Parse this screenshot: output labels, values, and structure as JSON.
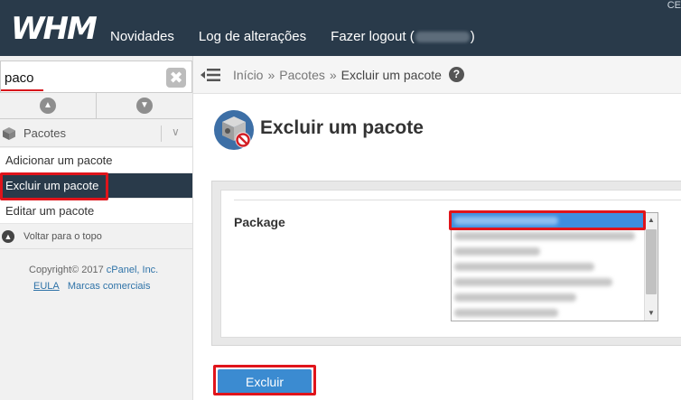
{
  "header": {
    "logo_text": "WHM",
    "nav": [
      "Novidades",
      "Log de alterações",
      "Fazer logout ("
    ],
    "logout_suffix": ")",
    "corner": "CE"
  },
  "sidebar": {
    "search": {
      "value": "paco",
      "placeholder": ""
    },
    "category": "Pacotes",
    "items": [
      {
        "label": "Adicionar um pacote",
        "active": false
      },
      {
        "label": "Excluir um pacote",
        "active": true
      },
      {
        "label": "Editar um pacote",
        "active": false
      }
    ],
    "back_to_top": "Voltar para o topo",
    "copyright_prefix": "Copyright© 2017 ",
    "copyright_link": "cPanel, Inc.",
    "footer_links": [
      "EULA",
      "Marcas comerciais"
    ]
  },
  "breadcrumb": {
    "items": [
      "Início",
      "Pacotes",
      "Excluir um pacote"
    ],
    "separator": "»",
    "help": "?"
  },
  "main": {
    "title": "Excluir um pacote",
    "package_label": "Package",
    "submit_label": "Excluir"
  },
  "colors": {
    "topbar": "#293a4a",
    "accent": "#3b8bd1",
    "highlight": "#e0141b",
    "selected_option": "#3f8edf"
  }
}
